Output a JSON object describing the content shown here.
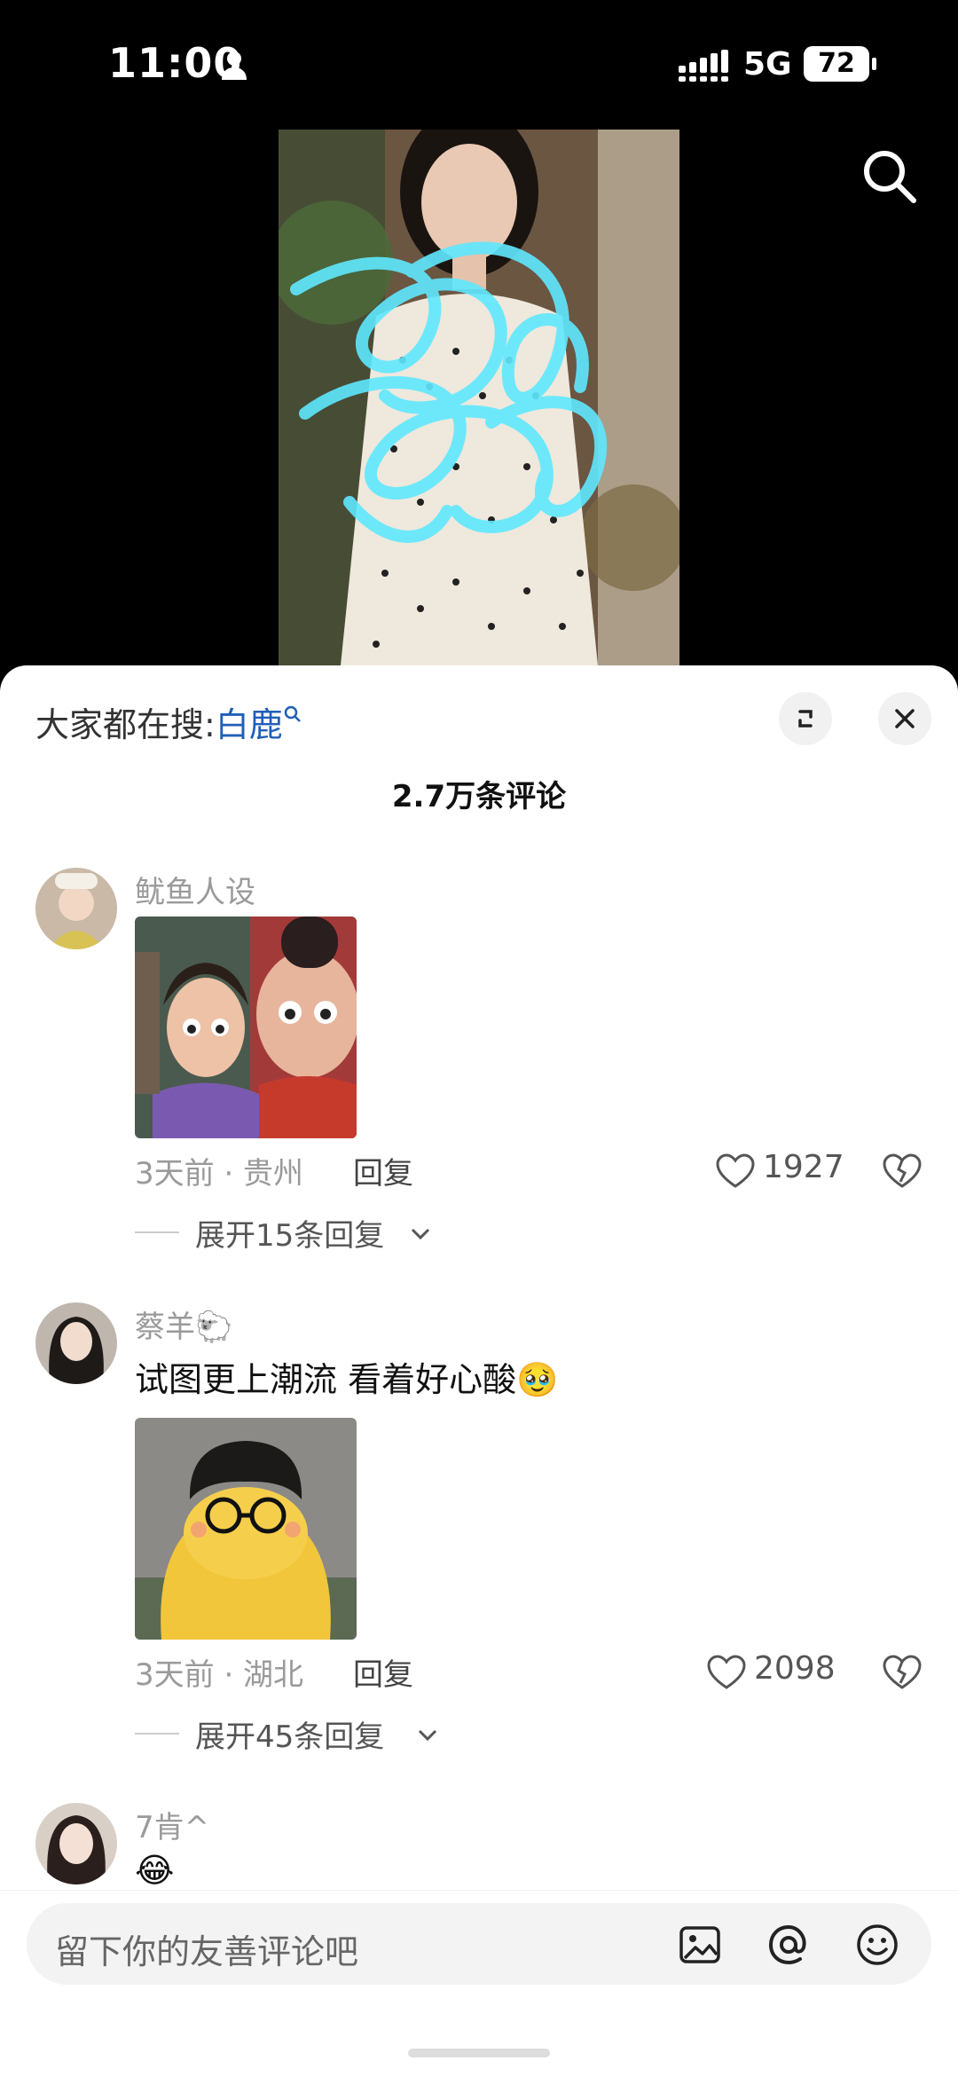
{
  "status": {
    "time": "11:00",
    "network": "5G",
    "battery": "72"
  },
  "header": {
    "hot_search_prefix": "大家都在搜:",
    "hot_search_keyword": "白鹿",
    "comment_count": "2.7万条评论"
  },
  "comments": [
    {
      "user": "鱿鱼人设",
      "text": "",
      "meta": "3天前 · 贵州",
      "reply": "回复",
      "likes": "1927",
      "expand": "展开15条回复"
    },
    {
      "user": "蔡羊🐑",
      "text": "试图更上潮流 看着好心酸🥹",
      "meta": "3天前 · 湖北",
      "reply": "回复",
      "likes": "2098",
      "expand": "展开45条回复"
    },
    {
      "user": "7肯^",
      "text": "😂"
    }
  ],
  "input": {
    "placeholder": "留下你的友善评论吧"
  },
  "icons": [
    "person-icon",
    "signal-icon",
    "search-icon",
    "expand-icon",
    "close-icon",
    "heart-icon",
    "dislike-icon",
    "chevron-down-icon",
    "image-icon",
    "at-icon",
    "emoji-icon"
  ],
  "colors": {
    "keyword": "#1f5fb8",
    "scribble": "#5fe8ff"
  }
}
